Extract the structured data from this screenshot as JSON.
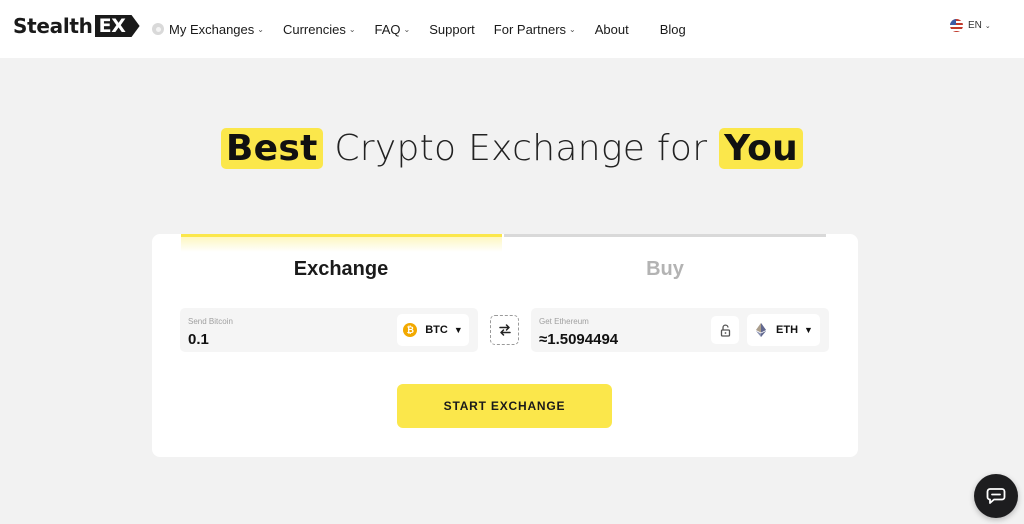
{
  "header": {
    "logo_text": "Stealth",
    "logo_badge": "EX",
    "nav": [
      {
        "label": "My Exchanges",
        "has_dropdown": true
      },
      {
        "label": "Currencies",
        "has_dropdown": true
      },
      {
        "label": "FAQ",
        "has_dropdown": true
      },
      {
        "label": "Support",
        "has_dropdown": false
      },
      {
        "label": "For Partners",
        "has_dropdown": true
      },
      {
        "label": "About",
        "has_dropdown": false
      },
      {
        "label": "Blog",
        "has_dropdown": false
      }
    ],
    "language": "EN"
  },
  "hero": {
    "word1": "Best",
    "middle": " Crypto Exchange for ",
    "word2": "You"
  },
  "widget": {
    "tabs": {
      "exchange": "Exchange",
      "buy": "Buy"
    },
    "send": {
      "label": "Send Bitcoin",
      "value": "0.1",
      "currency": "BTC",
      "icon": "bitcoin-icon"
    },
    "get": {
      "label": "Get Ethereum",
      "value": "≈1.5094494",
      "currency": "ETH",
      "icon": "ethereum-icon"
    },
    "submit_label": "START EXCHANGE"
  },
  "colors": {
    "accent": "#fbe74b",
    "background": "#f2f2f2",
    "card": "#ffffff",
    "btc": "#f2a900"
  }
}
